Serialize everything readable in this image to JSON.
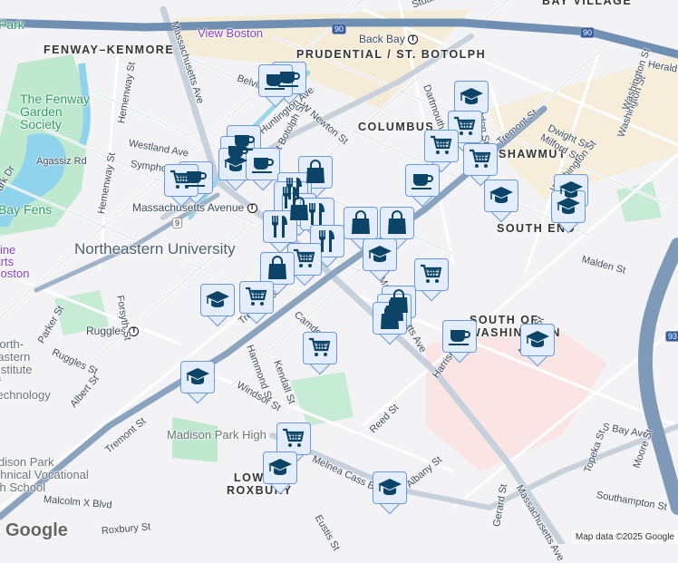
{
  "map": {
    "attribution": "Map data ©2025 Google",
    "logo": "Google",
    "colors": {
      "marker_bg": "#e4edfc",
      "marker_border": "#6d97dc",
      "marker_icon": "#0b4466",
      "highway": "#7f99b8",
      "park": "#bfe9cf",
      "water": "#8fd3ec"
    },
    "neighborhoods": [
      "FENWAY–KENMORE",
      "PRUDENTIAL / ST. BOTOLPH",
      "BAY VILLAGE",
      "COLUMBUS",
      "SHAWMUT",
      "SOUTH END",
      "SOUTH OF WASHINGTON",
      "LOWER ROXBURY"
    ],
    "places": {
      "northeastern": "Northeastern University",
      "fenway_garden": "The Fenway Garden Society",
      "view_boston": "View Boston",
      "museum": "Fine Arts Boston",
      "madison": "Madison Park High",
      "tech": "Madison Park Technical Vocational High School",
      "bay_fens": "Bay Fens",
      "back_bay": "Back Bay",
      "mass_ave_station": "Massachusetts Avenue",
      "ruggles": "Ruggles",
      "park_tl": "Park",
      "north": "North­eastern Institute of Technology"
    },
    "streets": [
      "Massachusetts Ave",
      "Westland Ave",
      "Hemenway St",
      "Hemenway St",
      "Agassiz Rd",
      "Symphony Rd",
      "Huntington Ave",
      "W Newton St",
      "St Botolph St",
      "Belvidere St",
      "Dartmouth St",
      "Clarendon St",
      "Tremont St",
      "Dwight St",
      "Milford St",
      "Washington St",
      "Washington St",
      "Herald St",
      "Malden St",
      "Forsyth St",
      "Parker St",
      "Ruggles St",
      "Albert St",
      "Tremont St",
      "Tremont St",
      "Hammond St",
      "Kendall St",
      "Camden St",
      "Windsor St",
      "Malcolm X Blvd",
      "Roxbury St",
      "Melnea Cass Blvd",
      "Eustis St",
      "Reed St",
      "Harrison Ave",
      "Albany St",
      "Albany St",
      "Massachusetts Ave",
      "Gerard St",
      "Massachusetts Ave",
      "S Bay Ave",
      "Topeka St",
      "Moore St",
      "Southampton St",
      "Stuart St",
      "Park Dr",
      "Washington St"
    ],
    "route_shields": [
      "90",
      "90",
      "93",
      "9"
    ],
    "markers": [
      {
        "category": "cafe"
      },
      {
        "category": "cafe"
      },
      {
        "category": "cafe"
      },
      {
        "category": "cafe"
      },
      {
        "category": "graduation"
      },
      {
        "category": "cafe"
      },
      {
        "category": "cafe"
      },
      {
        "category": "grocery"
      },
      {
        "category": "shopping"
      },
      {
        "category": "restaurant"
      },
      {
        "category": "restaurant"
      },
      {
        "category": "shopping"
      },
      {
        "category": "restaurant"
      },
      {
        "category": "restaurant"
      },
      {
        "category": "shopping"
      },
      {
        "category": "shopping"
      },
      {
        "category": "restaurant"
      },
      {
        "category": "grocery"
      },
      {
        "category": "shopping"
      },
      {
        "category": "graduation"
      },
      {
        "category": "grocery"
      },
      {
        "category": "shopping"
      },
      {
        "category": "shopping"
      },
      {
        "category": "shopping"
      },
      {
        "category": "grocery"
      },
      {
        "category": "graduation"
      },
      {
        "category": "grocery"
      },
      {
        "category": "graduation"
      },
      {
        "category": "grocery"
      },
      {
        "category": "graduation"
      },
      {
        "category": "graduation"
      },
      {
        "category": "cafe"
      },
      {
        "category": "graduation"
      },
      {
        "category": "graduation"
      },
      {
        "category": "grocery"
      },
      {
        "category": "grocery"
      },
      {
        "category": "grocery"
      },
      {
        "category": "cafe"
      },
      {
        "category": "graduation"
      },
      {
        "category": "graduation"
      },
      {
        "category": "graduation"
      }
    ]
  }
}
